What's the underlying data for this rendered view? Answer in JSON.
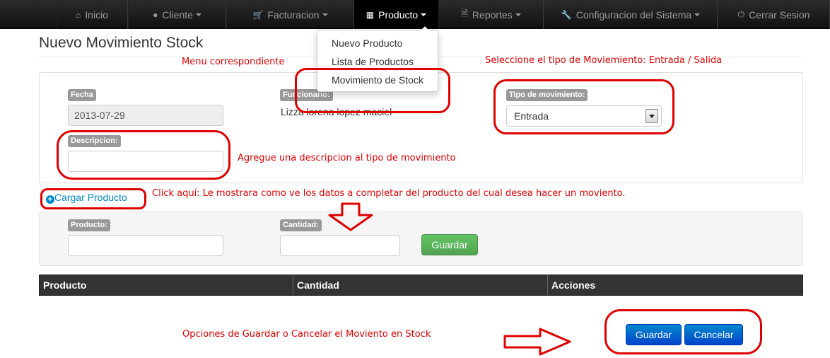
{
  "nav": {
    "items": [
      {
        "label": "Inicio",
        "icon": "home-icon"
      },
      {
        "label": "Cliente",
        "icon": "user-icon"
      },
      {
        "label": "Facturacion",
        "icon": "cart-icon"
      },
      {
        "label": "Producto",
        "icon": "barcode-icon"
      },
      {
        "label": "Reportes",
        "icon": "file-icon"
      },
      {
        "label": "Configuracion del Sistema",
        "icon": "wrench-icon"
      },
      {
        "label": "Cerrar Sesion",
        "icon": "power-icon"
      }
    ],
    "dropdown": [
      "Nuevo Producto",
      "Lista de Productos",
      "Movimiento de Stock"
    ]
  },
  "page": {
    "title": "Nuevo Movimiento Stock"
  },
  "form": {
    "fecha_label": "Fecha",
    "fecha_value": "2013-07-29",
    "funcionario_label": "Funcionario:",
    "funcionario_value": "Lizza lorena lopez maciel",
    "tipo_label": "Tipo de movimiento:",
    "tipo_value": "Entrada",
    "descripcion_label": "Descripcion:",
    "descripcion_value": ""
  },
  "cargar_producto": "Cargar Producto",
  "product_form": {
    "producto_label": "Producto:",
    "cantidad_label": "Cantidad:",
    "guardar": "Guardar"
  },
  "table": {
    "headers": [
      "Producto",
      "Cantidad",
      "Acciones"
    ]
  },
  "actions": {
    "guardar": "Guardar",
    "cancelar": "Cancelar"
  },
  "annotations": {
    "menu": "Menu correspondiente",
    "tipo": "Seleccione el tipo de Moviemiento: Entrada / Salida",
    "descripcion": "Agregue una descripcion al tipo de movimiento",
    "click": "Click aquí: Le mostrara como ve los datos a completar del producto del cual desea hacer un moviento.",
    "opciones": "Opciones de Guardar o Cancelar el Moviento en Stock"
  },
  "colors": {
    "annotation": "#e00000",
    "link": "#0088cc",
    "primary": "#0066cc",
    "success": "#5bb75b"
  }
}
